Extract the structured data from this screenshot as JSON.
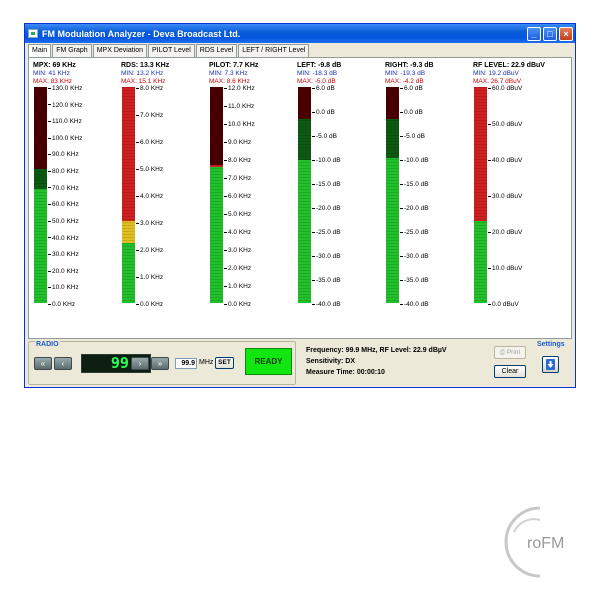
{
  "window": {
    "title": "FM Modulation Analyzer - Deva Broadcast Ltd.",
    "minimize_icon": "minimize-icon",
    "maximize_icon": "maximize-icon",
    "close_icon": "close-icon"
  },
  "tabs": [
    {
      "label": "Main",
      "active": true
    },
    {
      "label": "FM Graph"
    },
    {
      "label": "MPX Deviation"
    },
    {
      "label": "PILOT Level"
    },
    {
      "label": "RDS Level"
    },
    {
      "label": "LEFT / RIGHT Level"
    }
  ],
  "meters": [
    {
      "title": "MPX:  69 KHz",
      "min": "MIN:  41 KHz",
      "max": "MAX:  83 KHz",
      "scale": [
        "130.0 KHz",
        "120.0 KHz",
        "110.0 KHz",
        "100.0 KHz",
        "90.0 KHz",
        "80.0 KHz",
        "70.0 KHz",
        "60.0 KHz",
        "50.0 KHz",
        "40.0 KHz",
        "30.0 KHz",
        "20.0 KHz",
        "10.0 KHz",
        "0.0 KHz"
      ],
      "level": 0.53,
      "warn_from": 0.62,
      "warn_color": "#d02020",
      "yellow": null
    },
    {
      "title": "RDS:  13.3 KHz",
      "min": "MIN: 13.2 KHz",
      "max": "MAX: 15.1 KHz",
      "scale": [
        "8.0 KHz",
        "7.0 KHz",
        "6.0 KHz",
        "5.0 KHz",
        "4.0 KHz",
        "3.0 KHz",
        "2.0 KHz",
        "1.0 KHz",
        "0.0 KHz"
      ],
      "level": 1.0,
      "warn_from": 0.38,
      "warn_color": "#d02020",
      "yellow": [
        0.28,
        0.38
      ]
    },
    {
      "title": "PILOT:  7.7 KHz",
      "min": "MIN:  7.3 KHz",
      "max": "MAX:  8.6 KHz",
      "scale": [
        "12.0 KHz",
        "11.0 KHz",
        "10.0 KHz",
        "9.0 KHz",
        "8.0 KHz",
        "7.0 KHz",
        "6.0 KHz",
        "5.0 KHz",
        "4.0 KHz",
        "3.0 KHz",
        "2.0 KHz",
        "1.0 KHz",
        "0.0 KHz"
      ],
      "level": 0.64,
      "warn_from": 0.63,
      "warn_color": "#d02020",
      "yellow": null
    },
    {
      "title": "LEFT:  -9.8 dB",
      "min": "MIN: -18.3 dB",
      "max": "MAX:  -5.0 dB",
      "scale": [
        "6.0 dB",
        "0.0 dB",
        "-5.0 dB",
        "-10.0 dB",
        "-15.0 dB",
        "-20.0 dB",
        "-25.0 dB",
        "-30.0 dB",
        "-35.0 dB",
        "-40.0 dB"
      ],
      "level": 0.66,
      "warn_from": 0.85,
      "warn_color": "#c02020",
      "yellow": null
    },
    {
      "title": "RIGHT:  -9.3 dB",
      "min": "MIN: -19.3 dB",
      "max": "MAX:  -4.2 dB",
      "scale": [
        "6.0 dB",
        "0.0 dB",
        "-5.0 dB",
        "-10.0 dB",
        "-15.0 dB",
        "-20.0 dB",
        "-25.0 dB",
        "-30.0 dB",
        "-35.0 dB",
        "-40.0 dB"
      ],
      "level": 0.67,
      "warn_from": 0.85,
      "warn_color": "#c02020",
      "yellow": null
    },
    {
      "title": "RF LEVEL:  22.9 dBuV",
      "min": "MIN: 19.2 dBuV",
      "max": "MAX: 26.7 dBuV",
      "scale": [
        "60.0 dBuV",
        "50.0 dBuV",
        "40.0 dBuV",
        "30.0 dBuV",
        "20.0 dBuV",
        "10.0 dBuV",
        "0.0 dBuV"
      ],
      "level": 1.0,
      "warn_from": 0.38,
      "warn_color": "#d02020",
      "yellow": null
    }
  ],
  "radio": {
    "label": "RADIO",
    "display": "99.9",
    "freq_value": "99.9",
    "freq_unit": "MHz",
    "set_label": "SET",
    "btn_prev2": "«",
    "btn_prev": "‹",
    "btn_next": "›",
    "btn_next2": "»",
    "status": "READY"
  },
  "info": {
    "line1": "Frequency: 99.9 MHz, RF Level: 22.9 dBµV",
    "line2": "Sensitivity: DX",
    "line3": "Measure Time: 00:00:10"
  },
  "actions": {
    "print": "Print",
    "clear": "Clear",
    "settings": "Settings"
  },
  "logo": {
    "text": "roFM"
  },
  "colors": {
    "green": "#22c02a",
    "dark_green": "#0d5a12",
    "red": "#d02020",
    "dark_red": "#4a0000"
  }
}
